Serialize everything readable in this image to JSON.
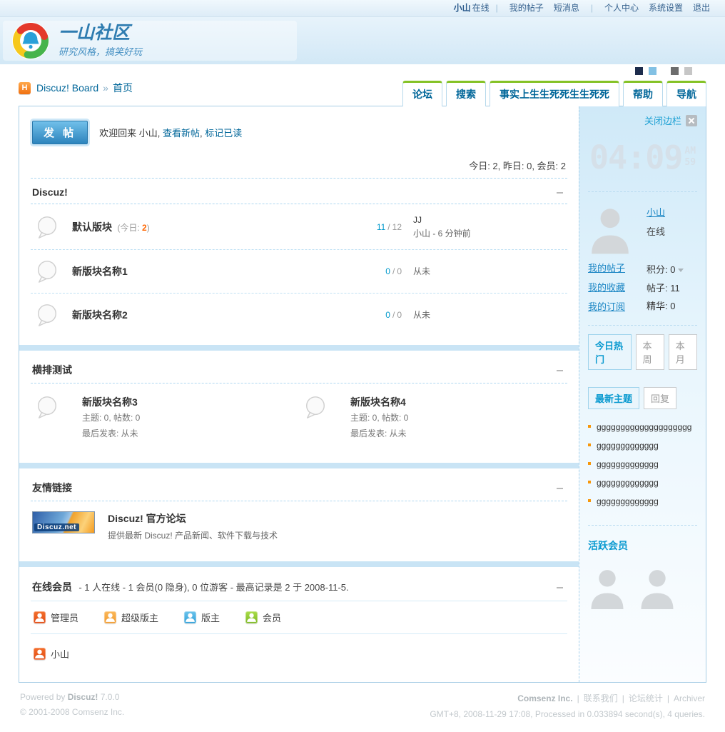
{
  "ui": {
    "pipe": "|",
    "slash": "/",
    "arrow": "»",
    "comma": ",",
    "home_glyph": "H"
  },
  "colors": {
    "accent_blue": "#0099cc",
    "link_blue": "#006699",
    "orange": "#ff6600",
    "tab_green": "#84c225",
    "panel_blue": "#cfe9f8",
    "group_admin": "#e85a1a",
    "group_super": "#f5a43c",
    "group_mod": "#4aafe0",
    "group_member": "#8fc832",
    "swatches": [
      "#1d2c4c",
      "#83c1e4",
      "#6d6d6d",
      "#c6c6c6"
    ]
  },
  "userbar": {
    "username": "小山",
    "status": "在线",
    "my_posts": "我的帖子",
    "messages": "短消息",
    "profile": "个人中心",
    "settings": "系统设置",
    "logout": "退出"
  },
  "site": {
    "name": "一山社区",
    "slogan": "研究风格，搞笑好玩"
  },
  "breadcrumb": {
    "root": "Discuz! Board",
    "current": "首页"
  },
  "tabs": [
    {
      "label": "论坛"
    },
    {
      "label": "搜索"
    },
    {
      "label": "事实上生生死死生生死死"
    },
    {
      "label": "帮助"
    },
    {
      "label": "导航"
    }
  ],
  "welcome": {
    "post_button": "发 帖",
    "greeting": "欢迎回来 小山,",
    "view_new": "查看新帖",
    "mark_read": "标记已读"
  },
  "board_stats": "今日: 2, 昨日: 0, 会员: 2",
  "category_discuz": {
    "title": "Discuz!",
    "forums": [
      {
        "name": "默认版块",
        "today_prefix": "(今日: ",
        "today": "2",
        "today_suffix": ")",
        "topics": "11",
        "posts": "12",
        "last_title": "JJ",
        "last_meta": "小山 - 6 分钟前"
      },
      {
        "name": "新版块名称1",
        "topics": "0",
        "posts": "0",
        "last_meta": "从未"
      },
      {
        "name": "新版块名称2",
        "topics": "0",
        "posts": "0",
        "last_meta": "从未"
      }
    ]
  },
  "category_hengpai": {
    "title": "横排测试",
    "forums": [
      {
        "name": "新版块名称3",
        "stats": "主题: 0, 帖数: 0",
        "last": "最后发表: 从未"
      },
      {
        "name": "新版块名称4",
        "stats": "主题: 0, 帖数: 0",
        "last": "最后发表: 从未"
      }
    ]
  },
  "friend_links": {
    "title": "友情链接",
    "banner_text": "Discuz.net",
    "link_title": "Discuz! 官方论坛",
    "link_desc": "提供最新 Discuz! 产品新闻、软件下载与技术"
  },
  "online": {
    "title": "在线会员",
    "summary": "- 1 人在线 - 1 会员(0 隐身), 0 位游客 - 最高记录是 2 于 2008-11-5.",
    "legend": [
      {
        "label": "管理员"
      },
      {
        "label": "超级版主"
      },
      {
        "label": "版主"
      },
      {
        "label": "会员"
      }
    ],
    "members": [
      {
        "name": "小山"
      }
    ]
  },
  "sidebar": {
    "close_label": "关闭边栏",
    "clock": {
      "time": "04:09",
      "ampm": "AM",
      "seconds": "59"
    },
    "user": {
      "name": "小山",
      "status": "在线",
      "link_posts": "我的帖子",
      "link_favs": "我的收藏",
      "link_subs": "我的订阅",
      "credit_label": "积分:",
      "credit": "0",
      "posts_label": "帖子:",
      "posts": "11",
      "digest_label": "精华:",
      "digest": "0"
    },
    "hot_tabs": [
      {
        "label": "今日热门"
      },
      {
        "label": "本周"
      },
      {
        "label": "本月"
      }
    ],
    "latest_tabs": [
      {
        "label": "最新主题"
      },
      {
        "label": "回复"
      }
    ],
    "topics": [
      "gggggggggggggggggggg",
      "ggggggggggggg",
      "ggggggggggggg",
      "ggggggggggggg",
      "ggggggggggggg"
    ],
    "active_title": "活跃会员"
  },
  "footer": {
    "powered_prefix": "Powered by",
    "product": "Discuz!",
    "version": "7.0.0",
    "copyright": "© 2001-2008 Comsenz Inc.",
    "company": "Comsenz Inc.",
    "links": [
      "联系我们",
      "论坛统计",
      "Archiver"
    ],
    "info": "GMT+8, 2008-11-29 17:08, Processed in 0.033894 second(s), 4 queries."
  }
}
